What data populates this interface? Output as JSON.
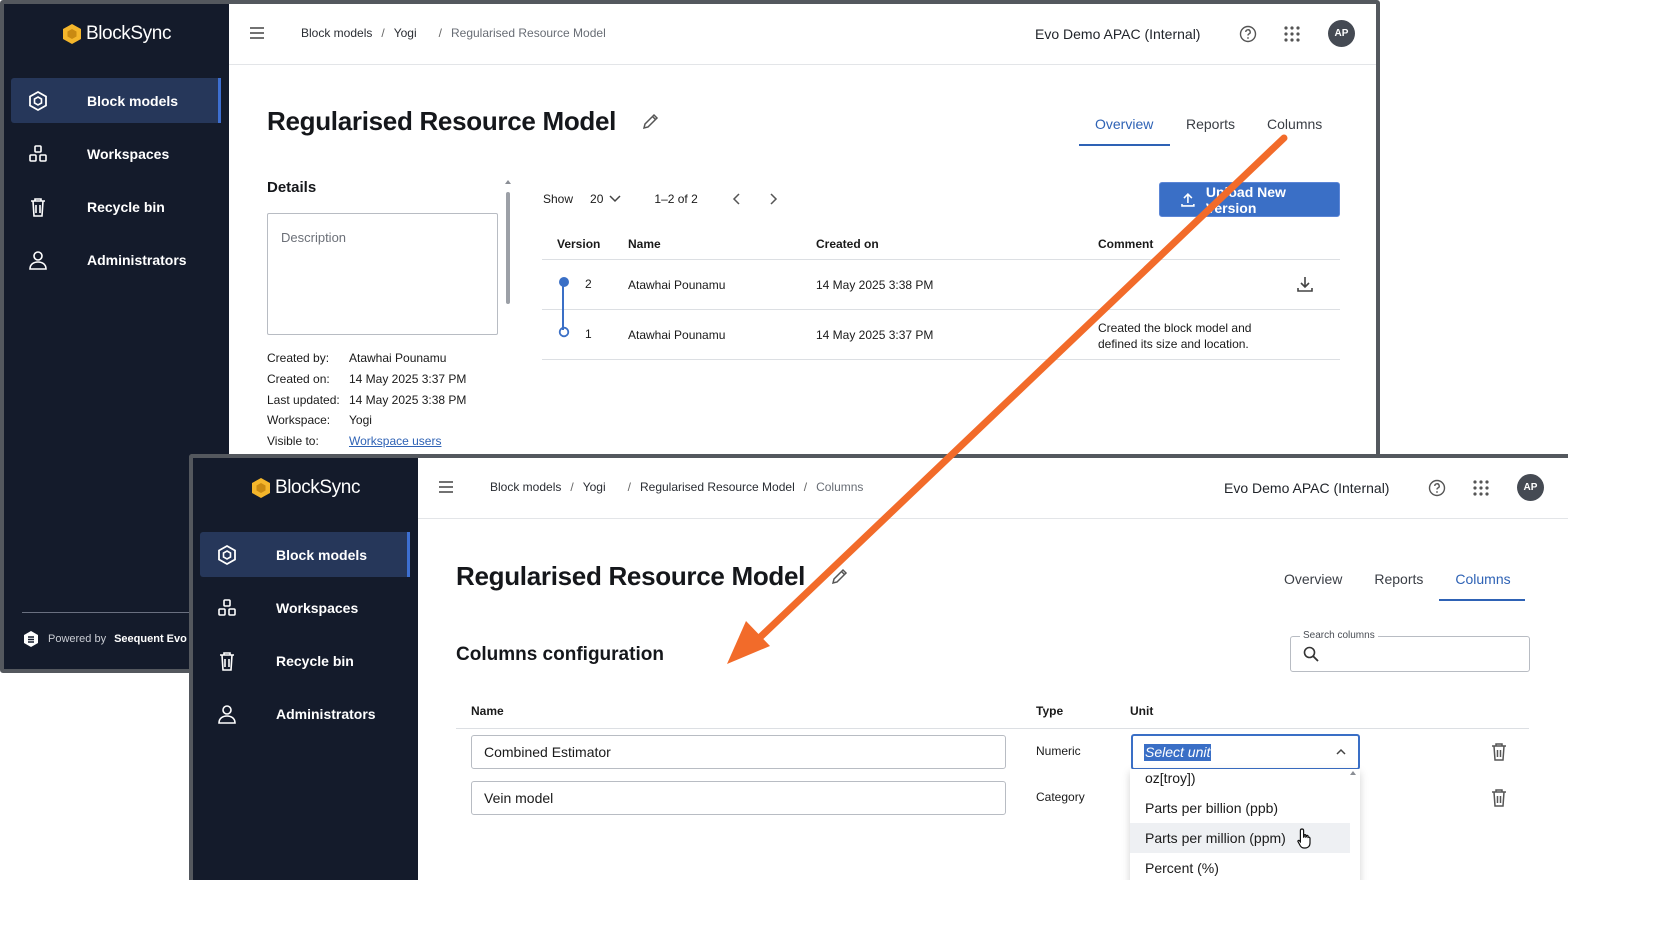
{
  "brand": {
    "name": "BlockSync",
    "powered_by": "Powered by",
    "powered_by_name": "Seequent Evo"
  },
  "nav": {
    "items": [
      {
        "label": "Block models"
      },
      {
        "label": "Workspaces"
      },
      {
        "label": "Recycle bin"
      },
      {
        "label": "Administrators"
      }
    ]
  },
  "header": {
    "org": "Evo Demo APAC (Internal)",
    "avatar_initials": "AP"
  },
  "page": {
    "title": "Regularised Resource Model"
  },
  "tabs": [
    "Overview",
    "Reports",
    "Columns"
  ],
  "overview": {
    "breadcrumbs": [
      "Block models",
      "Yogi",
      "Regularised Resource Model"
    ],
    "details_title": "Details",
    "description_placeholder": "Description",
    "meta": [
      {
        "key": "Created by:",
        "value": "Atawhai Pounamu"
      },
      {
        "key": "Created on:",
        "value": "14 May 2025 3:37 PM"
      },
      {
        "key": "Last updated:",
        "value": "14 May 2025 3:38 PM"
      },
      {
        "key": "Workspace:",
        "value": "Yogi"
      },
      {
        "key": "Visible to:",
        "value": "Workspace users"
      }
    ],
    "pager": {
      "show_label": "Show",
      "page_size": "20",
      "range": "1–2 of 2"
    },
    "upload_button": "Upload New Version",
    "table": {
      "headers": [
        "Version",
        "Name",
        "Created on",
        "Comment"
      ],
      "rows": [
        {
          "version": "2",
          "name": "Atawhai Pounamu",
          "created": "14 May 2025 3:38 PM",
          "comment_1": "",
          "comment_2": ""
        },
        {
          "version": "1",
          "name": "Atawhai Pounamu",
          "created": "14 May 2025 3:37 PM",
          "comment_1": "Created the block model and",
          "comment_2": "defined its size and location."
        }
      ]
    }
  },
  "columns_view": {
    "breadcrumbs": [
      "Block models",
      "Yogi",
      "Regularised Resource Model",
      "Columns"
    ],
    "section_title": "Columns configuration",
    "search_label": "Search columns",
    "table_headers": [
      "Name",
      "Type",
      "Unit"
    ],
    "rows": [
      {
        "name": "Combined Estimator",
        "type": "Numeric"
      },
      {
        "name": "Vein model",
        "type": "Category"
      }
    ],
    "unit_select_value": "Select unit",
    "unit_options": [
      "oz[troy])",
      "Parts per billion (ppb)",
      "Parts per million (ppm)",
      "Percent (%)"
    ]
  },
  "colors": {
    "sidebar": "#141b2b",
    "accent": "#3a6fc6",
    "arrow": "#f26b2a",
    "logo": "#f4b62b"
  }
}
